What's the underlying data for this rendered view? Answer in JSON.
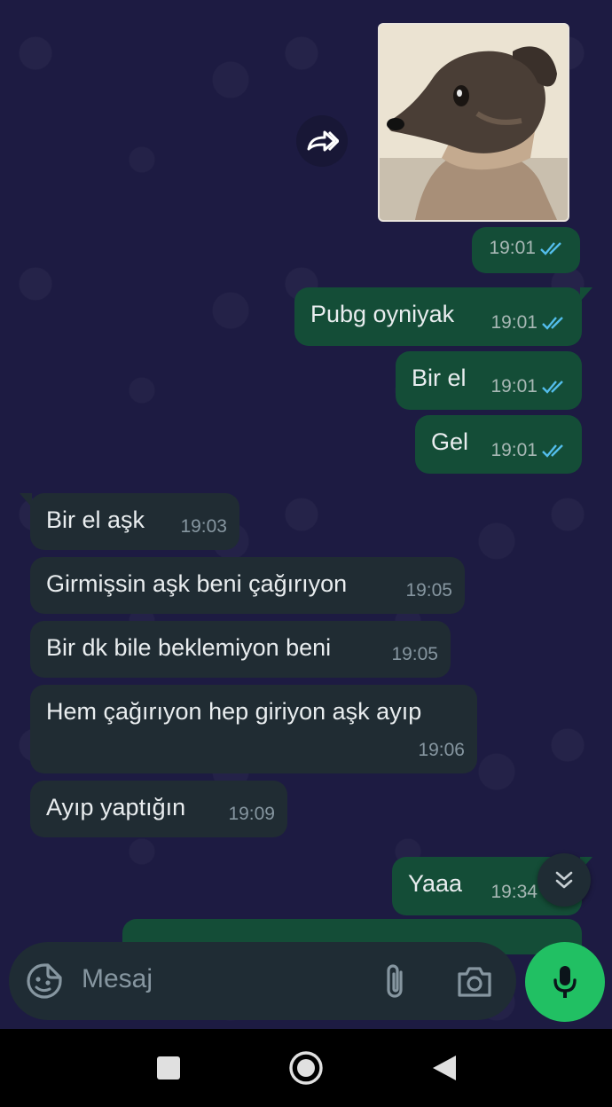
{
  "messages": [
    {
      "dir": "out",
      "type": "image",
      "time": "19:01",
      "read": true
    },
    {
      "dir": "out",
      "text": "Pubg oyniyak",
      "time": "19:01",
      "read": true
    },
    {
      "dir": "out",
      "text": "Bir el",
      "time": "19:01",
      "read": true
    },
    {
      "dir": "out",
      "text": "Gel",
      "time": "19:01",
      "read": true
    },
    {
      "dir": "in",
      "text": "Bir el aşk",
      "time": "19:03"
    },
    {
      "dir": "in",
      "text": "Girmişsin aşk beni çağırıyon",
      "time": "19:05"
    },
    {
      "dir": "in",
      "text": "Bir dk bile beklemiyon beni",
      "time": "19:05"
    },
    {
      "dir": "in",
      "text": "Hem çağırıyon hep giriyon aşk ayıp",
      "time": "19:06"
    },
    {
      "dir": "in",
      "text": "Ayıp yaptığın",
      "time": "19:09"
    },
    {
      "dir": "out",
      "text": "Yaaa",
      "time": "19:34",
      "read": true
    }
  ],
  "composer": {
    "placeholder": "Mesaj"
  },
  "icons": {
    "forward": "forward-icon",
    "sticker": "sticker-icon",
    "attach": "paperclip-icon",
    "camera": "camera-icon",
    "mic": "mic-icon",
    "scroll": "chevron-double-down-icon",
    "nav": [
      "square-icon",
      "circle-icon",
      "back-triangle-icon"
    ]
  },
  "colors": {
    "outgoing": "#144d37",
    "incoming": "#202c33",
    "read_ticks": "#53bdeb",
    "accent": "#21c063",
    "background": "#1d1b42"
  }
}
